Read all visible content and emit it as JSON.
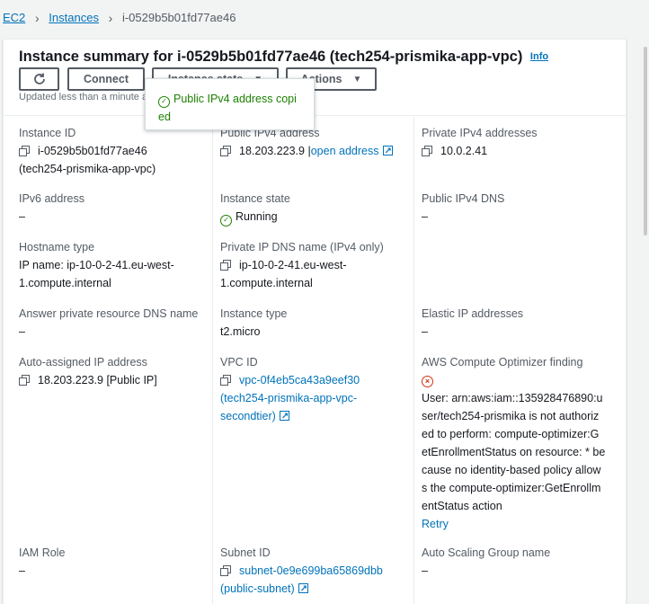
{
  "breadcrumb": {
    "root": "EC2",
    "section": "Instances",
    "current": "i-0529b5b01fd77ae46"
  },
  "header": {
    "title": "Instance summary for i-0529b5b01fd77ae46 (tech254-prismika-app-vpc)",
    "info": "Info",
    "refresh_icon": "refresh-icon",
    "connect": "Connect",
    "instance_state": "Instance state",
    "actions": "Actions",
    "updated": "Updated less than a minute a"
  },
  "tooltip": {
    "text_line1": "Public IPv4 address copi",
    "text_line2": "ed"
  },
  "fields": {
    "instance_id": {
      "label": "Instance ID",
      "value_line1": "i-0529b5b01fd77ae46",
      "value_line2": "(tech254-prismika-app-vpc)"
    },
    "public_ipv4": {
      "label": "Public IPv4 address",
      "value": "18.203.223.9",
      "link": "open address"
    },
    "private_ipv4": {
      "label": "Private IPv4 addresses",
      "value": "10.0.2.41"
    },
    "ipv6": {
      "label": "IPv6 address",
      "value": "–"
    },
    "instance_state": {
      "label": "Instance state",
      "value": "Running"
    },
    "public_dns": {
      "label": "Public IPv4 DNS",
      "value": "–"
    },
    "hostname_type": {
      "label": "Hostname type",
      "value_line1": "IP name: ip-10-0-2-41.eu-west-",
      "value_line2": "1.compute.internal"
    },
    "private_dns": {
      "label": "Private IP DNS name (IPv4 only)",
      "value_line1": "ip-10-0-2-41.eu-west-",
      "value_line2": "1.compute.internal"
    },
    "answer_dns": {
      "label": "Answer private resource DNS name",
      "value": "–"
    },
    "instance_type": {
      "label": "Instance type",
      "value": "t2.micro"
    },
    "elastic_ip": {
      "label": "Elastic IP addresses",
      "value": "–"
    },
    "auto_ip": {
      "label": "Auto-assigned IP address",
      "value": "18.203.223.9 [Public IP]"
    },
    "vpc_id": {
      "label": "VPC ID",
      "value_line1": "vpc-0f4eb5ca43a9eef30",
      "value_line2": "(tech254-prismika-app-vpc-",
      "value_line3": "secondtier)"
    },
    "optimizer": {
      "label": "AWS Compute Optimizer finding",
      "lines": [
        "User: arn:aws:iam::135928476890:u",
        "ser/tech254-prismika is not authoriz",
        "ed to perform: compute-optimizer:G",
        "etEnrollmentStatus on resource: * be",
        "cause no identity-based policy allow",
        "s the compute-optimizer:GetEnrollm",
        "entStatus action"
      ],
      "retry": "Retry"
    },
    "iam_role": {
      "label": "IAM Role",
      "value": "–"
    },
    "subnet_id": {
      "label": "Subnet ID",
      "value_line1": "subnet-0e9e699ba65869dbb",
      "value_line2": "(public-subnet)"
    },
    "asg_name": {
      "label": "Auto Scaling Group name",
      "value": "–"
    }
  }
}
